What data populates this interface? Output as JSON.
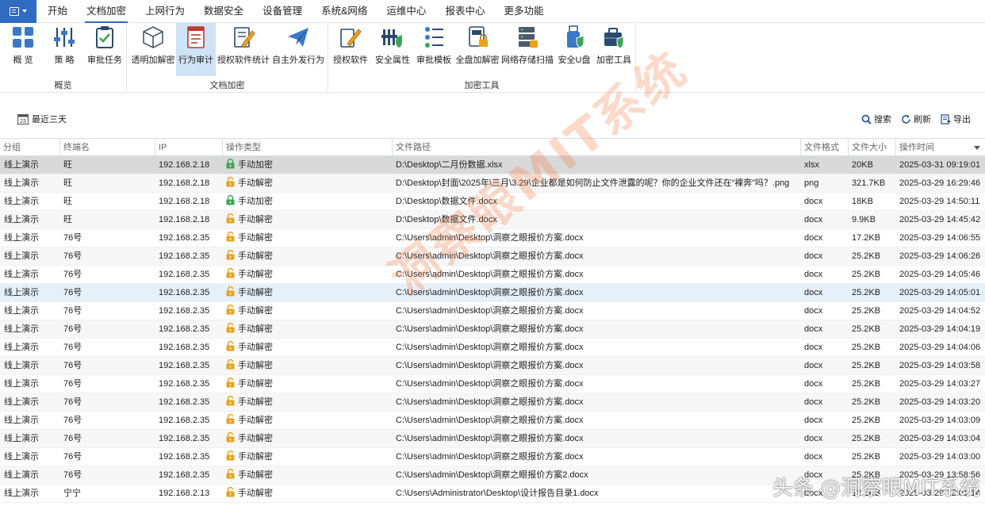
{
  "menubar": {
    "tabs": [
      "开始",
      "文档加密",
      "上网行为",
      "数据安全",
      "设备管理",
      "系统&网络",
      "运维中心",
      "报表中心",
      "更多功能"
    ],
    "active_tab": "文档加密"
  },
  "ribbon": {
    "groups": [
      {
        "label": "概览",
        "buttons": [
          "概 览",
          "策 略",
          "审批任务"
        ]
      },
      {
        "label": "文档加密",
        "buttons": [
          "透明加解密",
          "行为审计",
          "授权软件统计",
          "自主外发行为"
        ]
      },
      {
        "label": "加密工具",
        "buttons": [
          "授权软件",
          "安全属性",
          "审批模板",
          "全盘加解密",
          "网络存储扫描",
          "安全U盘",
          "加密工具"
        ]
      }
    ],
    "selected_button": "行为审计"
  },
  "toolbar": {
    "date_filter": "最近三天",
    "calendar_day": "23",
    "search": "搜索",
    "refresh": "刷新",
    "export": "导出"
  },
  "table": {
    "headers": [
      "分组",
      "终端名",
      "IP",
      "操作类型",
      "文件路径",
      "文件格式",
      "文件大小",
      "操作时间"
    ],
    "rows": [
      {
        "group": "线上演示",
        "terminal": "旺",
        "ip": "192.168.2.18",
        "op": "手动加密",
        "path": "D:\\Desktop\\二月份数据.xlsx",
        "fmt": "xlsx",
        "size": "20KB",
        "time": "2025-03-31 09:19:01"
      },
      {
        "group": "线上演示",
        "terminal": "旺",
        "ip": "192.168.2.18",
        "op": "手动解密",
        "path": "D:\\Desktop\\封面\\2025年\\三月\\3.29\\企业都是如何防止文件泄露的呢？你的企业文件还在“裸奔”吗？.png",
        "fmt": "png",
        "size": "321.7KB",
        "time": "2025-03-29 16:29:46"
      },
      {
        "group": "线上演示",
        "terminal": "旺",
        "ip": "192.168.2.18",
        "op": "手动加密",
        "path": "D:\\Desktop\\数据文件.docx",
        "fmt": "docx",
        "size": "18KB",
        "time": "2025-03-29 14:50:11"
      },
      {
        "group": "线上演示",
        "terminal": "旺",
        "ip": "192.168.2.18",
        "op": "手动解密",
        "path": "D:\\Desktop\\数据文件.docx",
        "fmt": "docx",
        "size": "9.9KB",
        "time": "2025-03-29 14:45:42"
      },
      {
        "group": "线上演示",
        "terminal": "76号",
        "ip": "192.168.2.35",
        "op": "手动解密",
        "path": "C:\\Users\\admin\\Desktop\\洞察之眼报价方案.docx",
        "fmt": "docx",
        "size": "17.2KB",
        "time": "2025-03-29 14:06:55"
      },
      {
        "group": "线上演示",
        "terminal": "76号",
        "ip": "192.168.2.35",
        "op": "手动解密",
        "path": "C:\\Users\\admin\\Desktop\\洞察之眼报价方案.docx",
        "fmt": "docx",
        "size": "25.2KB",
        "time": "2025-03-29 14:06:26"
      },
      {
        "group": "线上演示",
        "terminal": "76号",
        "ip": "192.168.2.35",
        "op": "手动解密",
        "path": "C:\\Users\\admin\\Desktop\\洞察之眼报价方案.docx",
        "fmt": "docx",
        "size": "25.2KB",
        "time": "2025-03-29 14:05:46"
      },
      {
        "group": "线上演示",
        "terminal": "76号",
        "ip": "192.168.2.35",
        "op": "手动解密",
        "path": "C:\\Users\\admin\\Desktop\\洞察之眼报价方案.docx",
        "fmt": "docx",
        "size": "25.2KB",
        "time": "2025-03-29 14:05:01"
      },
      {
        "group": "线上演示",
        "terminal": "76号",
        "ip": "192.168.2.35",
        "op": "手动解密",
        "path": "C:\\Users\\admin\\Desktop\\洞察之眼报价方案.docx",
        "fmt": "docx",
        "size": "25.2KB",
        "time": "2025-03-29 14:04:52"
      },
      {
        "group": "线上演示",
        "terminal": "76号",
        "ip": "192.168.2.35",
        "op": "手动解密",
        "path": "C:\\Users\\admin\\Desktop\\洞察之眼报价方案.docx",
        "fmt": "docx",
        "size": "25.2KB",
        "time": "2025-03-29 14:04:19"
      },
      {
        "group": "线上演示",
        "terminal": "76号",
        "ip": "192.168.2.35",
        "op": "手动解密",
        "path": "C:\\Users\\admin\\Desktop\\洞察之眼报价方案.docx",
        "fmt": "docx",
        "size": "25.2KB",
        "time": "2025-03-29 14:04:06"
      },
      {
        "group": "线上演示",
        "terminal": "76号",
        "ip": "192.168.2.35",
        "op": "手动解密",
        "path": "C:\\Users\\admin\\Desktop\\洞察之眼报价方案.docx",
        "fmt": "docx",
        "size": "25.2KB",
        "time": "2025-03-29 14:03:58"
      },
      {
        "group": "线上演示",
        "terminal": "76号",
        "ip": "192.168.2.35",
        "op": "手动解密",
        "path": "C:\\Users\\admin\\Desktop\\洞察之眼报价方案.docx",
        "fmt": "docx",
        "size": "25.2KB",
        "time": "2025-03-29 14:03:27"
      },
      {
        "group": "线上演示",
        "terminal": "76号",
        "ip": "192.168.2.35",
        "op": "手动解密",
        "path": "C:\\Users\\admin\\Desktop\\洞察之眼报价方案.docx",
        "fmt": "docx",
        "size": "25.2KB",
        "time": "2025-03-29 14:03:20"
      },
      {
        "group": "线上演示",
        "terminal": "76号",
        "ip": "192.168.2.35",
        "op": "手动解密",
        "path": "C:\\Users\\admin\\Desktop\\洞察之眼报价方案.docx",
        "fmt": "docx",
        "size": "25.2KB",
        "time": "2025-03-29 14:03:09"
      },
      {
        "group": "线上演示",
        "terminal": "76号",
        "ip": "192.168.2.35",
        "op": "手动解密",
        "path": "C:\\Users\\admin\\Desktop\\洞察之眼报价方案.docx",
        "fmt": "docx",
        "size": "25.2KB",
        "time": "2025-03-29 14:03:04"
      },
      {
        "group": "线上演示",
        "terminal": "76号",
        "ip": "192.168.2.35",
        "op": "手动解密",
        "path": "C:\\Users\\admin\\Desktop\\洞察之眼报价方案.docx",
        "fmt": "docx",
        "size": "25.2KB",
        "time": "2025-03-29 14:03:00"
      },
      {
        "group": "线上演示",
        "terminal": "76号",
        "ip": "192.168.2.35",
        "op": "手动解密",
        "path": "C:\\Users\\admin\\Desktop\\洞察之眼报价方案2.docx",
        "fmt": "docx",
        "size": "25.2KB",
        "time": "2025-03-29 13:58:56"
      },
      {
        "group": "线上演示",
        "terminal": "宁宁",
        "ip": "192.168.2.13",
        "op": "手动解密",
        "path": "C:\\Users\\Administrator\\Desktop\\设计报告目录1.docx",
        "fmt": "docx",
        "size": "12.1KB",
        "time": "2025-03-29 12:01:14"
      }
    ]
  },
  "watermark": {
    "diagonal": "洞察眼MIT系统",
    "corner": "头条 @洞察眼MIT系统"
  },
  "colors": {
    "accent": "#2f6bbf",
    "lock_green": "#3aa655",
    "lock_gold": "#e8a317",
    "selected_row": "#d9d9d9",
    "ribbon_selected": "#cfe3f6"
  }
}
